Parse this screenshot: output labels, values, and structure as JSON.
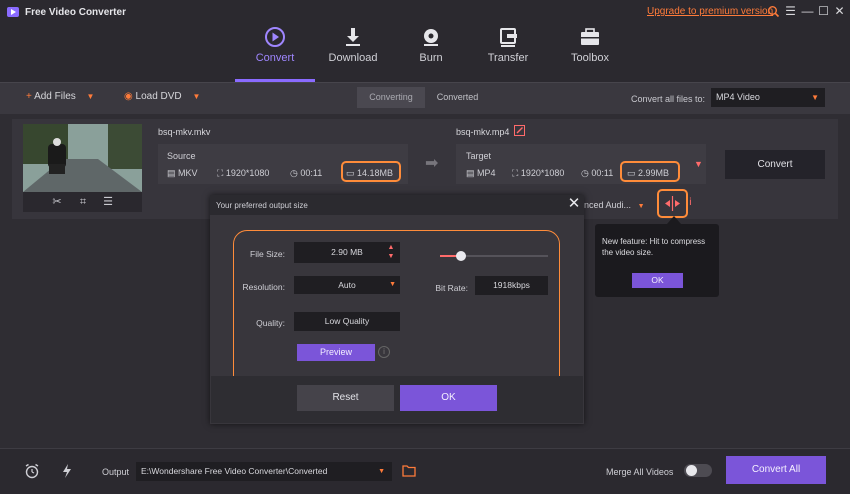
{
  "app": {
    "title": "Free Video Converter",
    "upgrade_link": "Upgrade to premium version",
    "accent": "#7b55d9",
    "highlight": "#ff8c3a"
  },
  "nav": {
    "items": [
      {
        "label": "Convert",
        "icon": "convert-icon",
        "active": true
      },
      {
        "label": "Download",
        "icon": "download-icon"
      },
      {
        "label": "Burn",
        "icon": "burn-icon"
      },
      {
        "label": "Transfer",
        "icon": "transfer-icon"
      },
      {
        "label": "Toolbox",
        "icon": "toolbox-icon"
      }
    ]
  },
  "toolbar": {
    "add_files": "Add Files",
    "load_dvd": "Load DVD",
    "tab_converting": "Converting",
    "tab_converted": "Converted",
    "convert_all_label": "Convert all files to:",
    "format": "MP4 Video"
  },
  "file": {
    "source_name": "bsq-mkv.mkv",
    "source_label": "Source",
    "source": {
      "format": "MKV",
      "resolution": "1920*1080",
      "duration": "00:11",
      "size": "14.18MB"
    },
    "target_name": "bsq-mkv.mp4",
    "target_label": "Target",
    "target": {
      "format": "MP4",
      "resolution": "1920*1080",
      "duration": "00:11",
      "size": "2.99MB"
    },
    "convert_button": "Convert",
    "audio_select": "nced Audi..."
  },
  "modal": {
    "title": "Your preferred output size",
    "file_size_label": "File Size:",
    "file_size_value": "2.90  MB",
    "resolution_label": "Resolution:",
    "resolution_value": "Auto",
    "quality_label": "Quality:",
    "quality_value": "Low Quality",
    "bitrate_label": "Bit Rate:",
    "bitrate_value": "1918kbps",
    "preview_button": "Preview",
    "preview_info": "i",
    "reset_button": "Reset",
    "ok_button": "OK",
    "slider_fraction": 0.19
  },
  "tooltip": {
    "text": "New feature: Hit to compress the video size.",
    "ok": "OK"
  },
  "bottom": {
    "output_label": "Output",
    "output_path": "E:\\Wondershare Free Video Converter\\Converted",
    "merge_label": "Merge All Videos",
    "convert_all_button": "Convert All"
  }
}
